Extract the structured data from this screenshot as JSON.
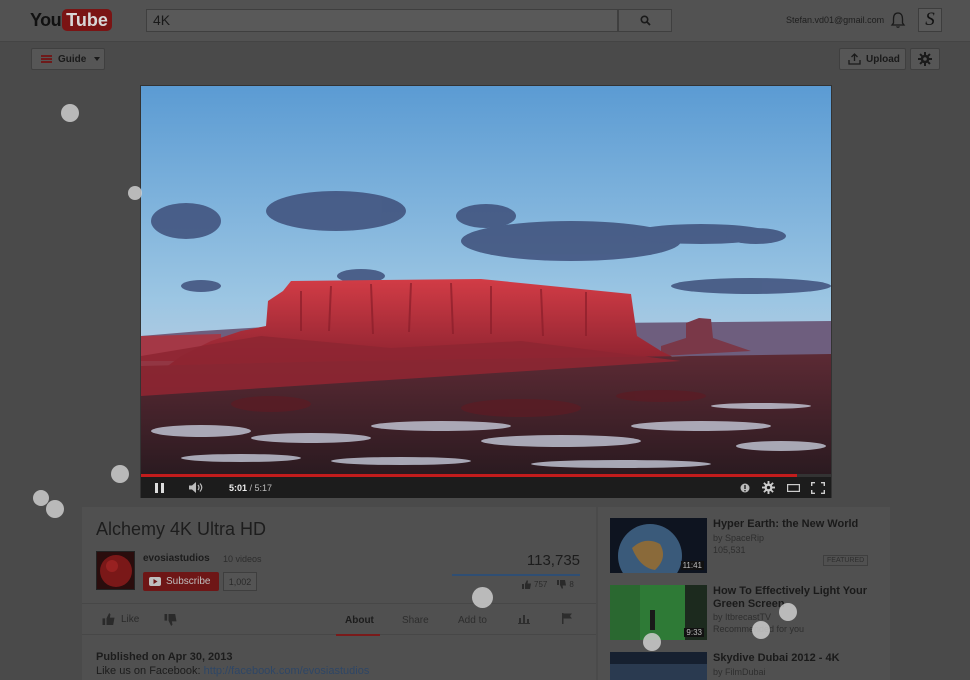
{
  "header": {
    "logo_you": "You",
    "logo_tube": "Tube",
    "search_value": "4K",
    "user_email": "Stefan.vd01@gmail.com",
    "avatar_letter": "S"
  },
  "subheader": {
    "guide_label": "Guide",
    "upload_label": "Upload"
  },
  "player": {
    "current_time": "5:01",
    "duration": "/ 5:17",
    "progress_fraction": 0.95
  },
  "video": {
    "title": "Alchemy 4K Ultra HD",
    "channel": "evosiastudios",
    "video_count": "10 videos",
    "subscribe_label": "Subscribe",
    "subscriber_count": "1,002",
    "views": "113,735",
    "likes": "757",
    "dislikes": "8",
    "like_label": "Like",
    "tabs": [
      "About",
      "Share",
      "Add to"
    ],
    "published": "Published on Apr 30, 2013",
    "fb_prefix": "Like us on Facebook:",
    "fb_link": "http://facebook.com/evosiastudios"
  },
  "recommendations": [
    {
      "title": "Hyper Earth: the New World",
      "by": "by SpaceRip",
      "meta": "105,531",
      "badge": "FEATURED",
      "duration": "11:41"
    },
    {
      "title": "How To Effectively Light Your Green Screen",
      "by": "by ItbrecastTV",
      "meta": "Recommended for you",
      "duration": "9:33"
    },
    {
      "title": "Skydive Dubai 2012 - 4K",
      "by": "by FilmDubai",
      "meta": ""
    }
  ],
  "colors": {
    "background": "#4a4a4a",
    "accent_red": "#c21c1c",
    "link_blue": "#2e4666"
  }
}
